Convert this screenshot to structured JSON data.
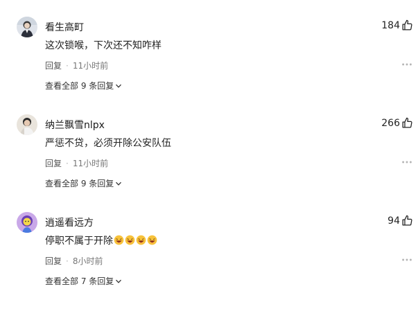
{
  "comments": [
    {
      "username": "看生高町",
      "likes": "184",
      "text": "这次锁喉，下次还不知咋样",
      "emoji_count": 0,
      "reply_label": "回复",
      "separator": "·",
      "time": "11小时前",
      "view_replies": "查看全部 9 条回复",
      "avatar_color": "#dfe3ea"
    },
    {
      "username": "纳兰飘雪nlpx",
      "likes": "266",
      "text": "严惩不贷，必须开除公安队伍",
      "emoji_count": 0,
      "reply_label": "回复",
      "separator": "·",
      "time": "11小时前",
      "view_replies": "查看全部 9 条回复",
      "avatar_color": "#e9e4dc"
    },
    {
      "username": "逍遥看远方",
      "likes": "94",
      "text": "停职不属于开除",
      "emoji_count": 4,
      "emoji_name": "laughing-face-emoji",
      "reply_label": "回复",
      "separator": "·",
      "time": "8小时前",
      "view_replies": "查看全部 7 条回复",
      "avatar_color": "#c9a8e8"
    }
  ],
  "icons": {
    "like": "thumbs-up-icon",
    "more": "more-options-icon",
    "expand": "chevron-down-icon"
  }
}
